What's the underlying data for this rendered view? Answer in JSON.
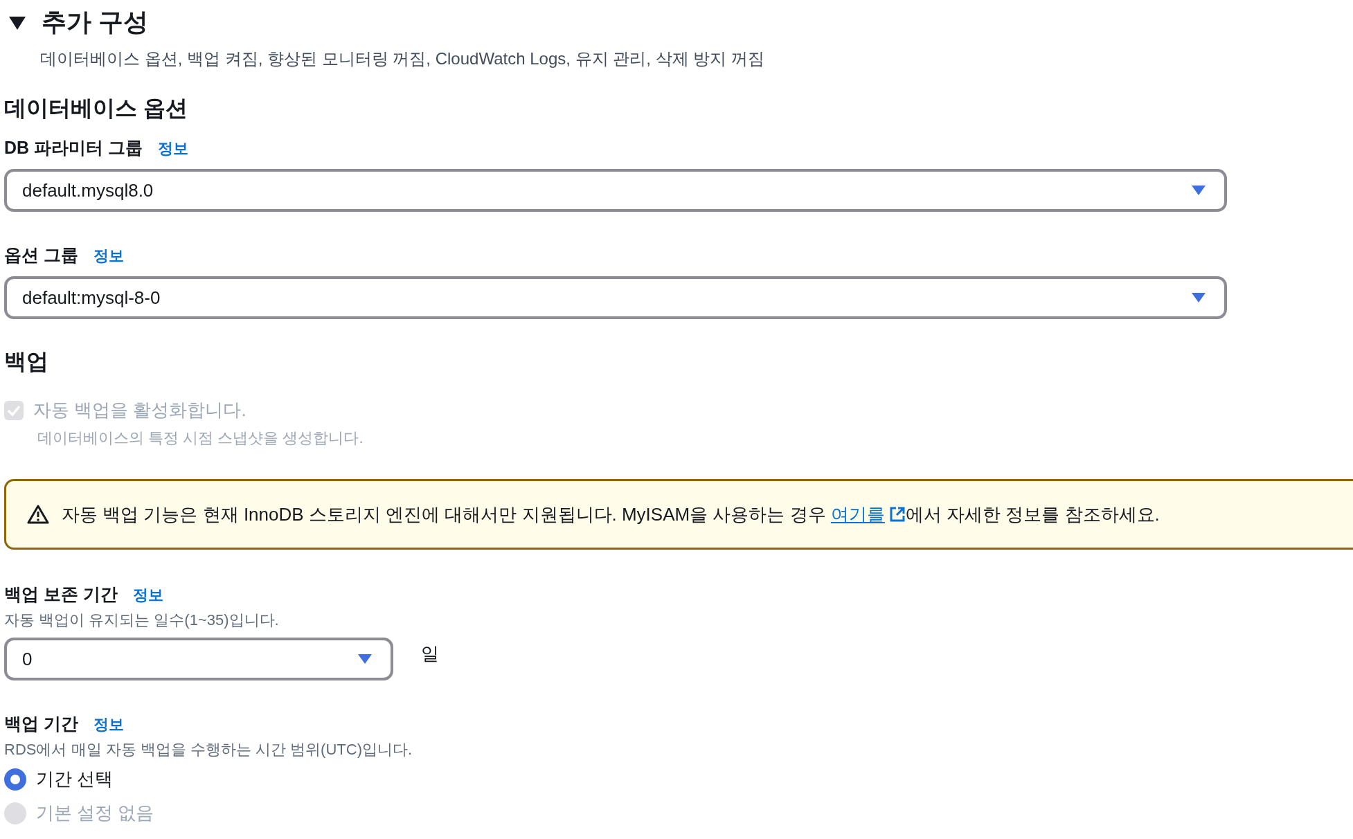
{
  "section": {
    "title": "추가 구성",
    "expanded": true,
    "summary": "데이터베이스 옵션, 백업 켜짐, 향상된 모니터링 꺼짐, CloudWatch Logs, 유지 관리, 삭제 방지 꺼짐"
  },
  "database_options": {
    "heading": "데이터베이스 옵션",
    "fields": [
      {
        "label": "DB 파라미터 그룹",
        "info": "정보",
        "value": "default.mysql8.0"
      },
      {
        "label": "옵션 그룹",
        "info": "정보",
        "value": "default:mysql-8-0"
      }
    ]
  },
  "backup": {
    "heading": "백업",
    "auto_backup": {
      "label": "자동 백업을 활성화합니다.",
      "description": "데이터베이스의 특정 시점 스냅샷을 생성합니다.",
      "checked": true,
      "disabled": true
    },
    "alert": {
      "before": "자동 백업 기능은 현재 InnoDB 스토리지 엔진에 대해서만 지원됩니다. MyISAM을 사용하는 경우 ",
      "link": "여기를",
      "after": "에서 자세한 정보를 참조하세요."
    },
    "retention": {
      "label": "백업 보존 기간",
      "info": "정보",
      "description": "자동 백업이 유지되는 일수(1~35)입니다.",
      "value": "0",
      "unit": "일"
    },
    "window": {
      "label": "백업 기간",
      "info": "정보",
      "description": "RDS에서 매일 자동 백업을 수행하는 시간 범위(UTC)입니다.",
      "options": [
        {
          "label": "기간 선택",
          "selected": true,
          "disabled": false
        },
        {
          "label": "기본 설정 없음",
          "selected": false,
          "disabled": true
        }
      ]
    }
  }
}
